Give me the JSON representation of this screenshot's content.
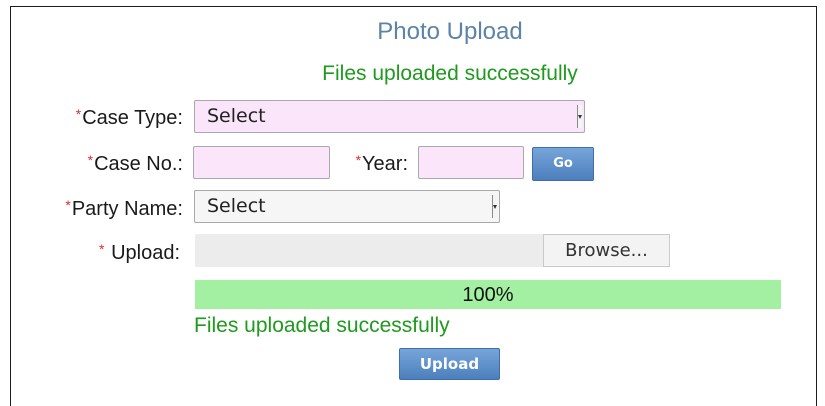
{
  "form": {
    "title": "Photo Upload",
    "status_message": "Files uploaded successfully",
    "required_marker": "*",
    "case_type": {
      "label": "Case Type:",
      "value": "Select"
    },
    "case_no": {
      "label": "Case No.:",
      "value": ""
    },
    "year": {
      "label": "Year:",
      "value": ""
    },
    "go_label": "Go",
    "party_name": {
      "label": "Party Name:",
      "value": "Select"
    },
    "upload_field": {
      "label": "Upload:",
      "browse_label": "Browse..."
    },
    "progress": {
      "percent": 100,
      "text": "100%"
    },
    "upload_message": "Files uploaded successfully",
    "upload_button_label": "Upload"
  },
  "colors": {
    "title": "#5b84a6",
    "success": "#1e9a1e",
    "required": "#d9302c",
    "input_bg": "#fbe5fb",
    "progress_fill": "#a3f0a3",
    "button": "#5f8fcb"
  }
}
